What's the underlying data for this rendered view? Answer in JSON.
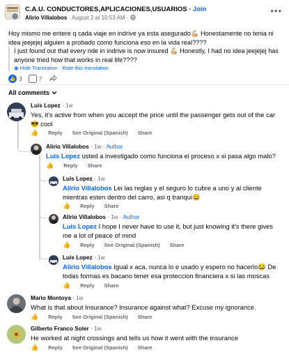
{
  "group": {
    "title": "C.A.U. CONDUCTORES,APLICACIONES,USUARIOS",
    "join_sep": " · ",
    "join_label": "Join",
    "author": "Alirio Villalobos",
    "meta_date": " · August 2 at 10:53 AM · ",
    "privacy_icon": "globe-icon",
    "more_icon": "more-icon"
  },
  "post": {
    "text": "Hoy mismo me entere q cada viaje en indrive ya esta asegurado💪🏼 Honestamente no tenia ni idea jeejejej alguien a probado como funciona eso en la vida real????",
    "translation": "I just found out that every ride in indrive is now insured 💪🏼 Honestly, I had no idea jeejejej has anyone tried how that works in real life????",
    "hide_translation": "Hide Translation",
    "rate_translation": "Rate this translation",
    "link_sep": " · ",
    "reaction_count": "3",
    "comment_count": "7",
    "share_label": ""
  },
  "comments_header": "All comments",
  "comments": [
    {
      "name": "Luis Lopez",
      "time": "1w",
      "text": "Yes, it's active from when you accept the price until the passenger gets out of the car 😎 cool",
      "like": "Like",
      "reply": "Reply",
      "see_original": "See Original (Spanish)",
      "share": "Share"
    },
    {
      "name": "Alirio Villalobos",
      "time": "1w",
      "author_tag": "Author",
      "mention": "Luis Lopez",
      "text": " usted a investigado como funciona el proceso x si pasa algo malo?",
      "like": "Like",
      "reply": "Reply",
      "share": "Share"
    },
    {
      "name": "Luis Lopez",
      "time": "1w",
      "mention": "Alirio Villalobos",
      "text": " Lei las reglas y el seguro lo cubre a uno y al cliente mientras esten dentro del carro, asi q tranqui😄",
      "like": "Like",
      "reply": "Reply",
      "share": "Share"
    },
    {
      "name": "Alirio Villalobos",
      "time": "1w",
      "author_tag": "Author",
      "mention": "Luis Lopez",
      "text": " I hope I never have to use it, but just knowing it's there gives me a lot of peace of mind",
      "like": "Like",
      "reply": "Reply",
      "see_original": "See Original (Spanish)",
      "share": "Share"
    },
    {
      "name": "Luis Lopez",
      "time": "1w",
      "mention": "Alirio Villalobos",
      "text": " Igual x aca, nunca lo e usado y espero no hacerlo😂 De todas formas es bacano tener esa proteccion financiera x si las moscas",
      "like": "Like",
      "reply": "Reply",
      "share": "Share"
    },
    {
      "name": "Mario Montoya",
      "time": "1w",
      "text": "What is that about Insurance? Insurance against what? Excuse my ignorance.",
      "like": "Like",
      "reply": "Reply",
      "see_original": "See Original (Spanish)",
      "share": "Share"
    },
    {
      "name": "Gilberto Franco Soler",
      "time": "1w",
      "text": "He worked at night crossings and tells us how it went with the insurance",
      "like": "Like",
      "reply": "Reply",
      "see_original": "See Original (Spanish)",
      "share": "Share"
    }
  ],
  "name_sep": " · ",
  "colors": {
    "accent": "#0866ff",
    "muted": "#65676b",
    "line": "#ced0d4"
  }
}
